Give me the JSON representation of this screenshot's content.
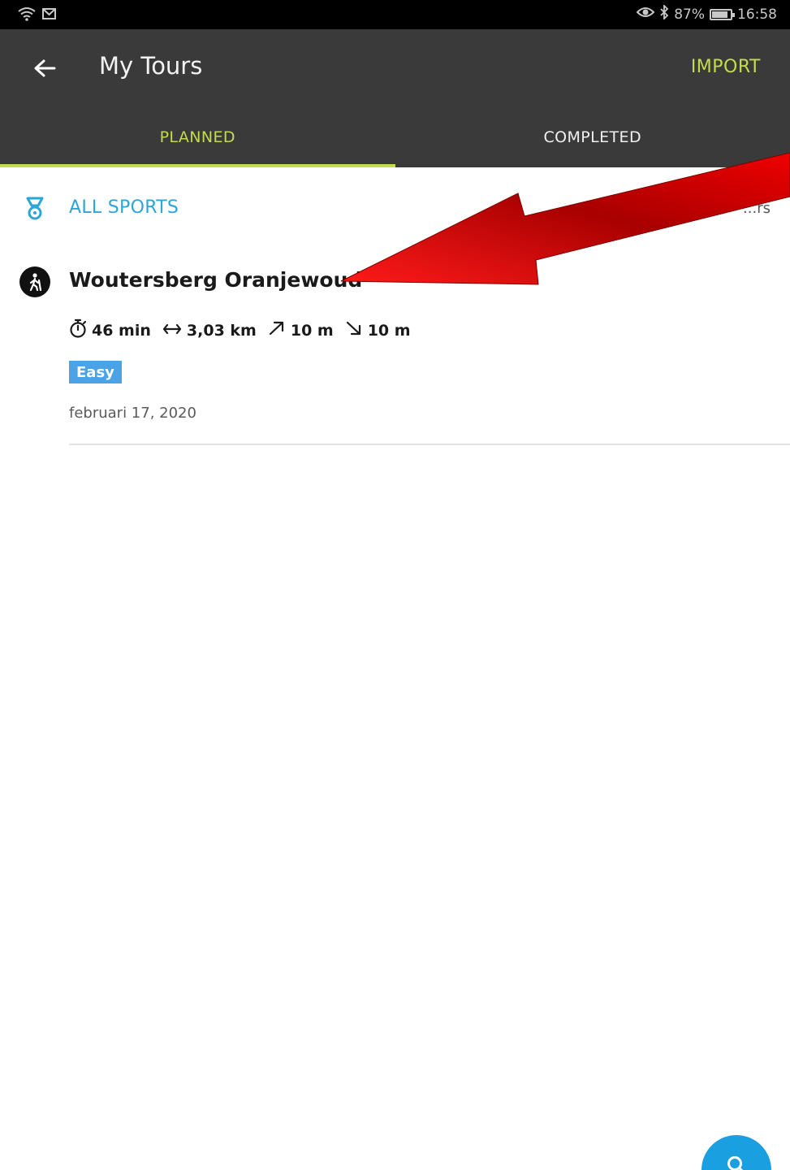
{
  "status_bar": {
    "left_icons": [
      "wifi-icon",
      "mail-icon"
    ],
    "right_icons": [
      "eye-icon",
      "bluetooth-icon",
      "battery-icon"
    ],
    "battery": "87%",
    "battery_level": 0.87,
    "time": "16:58"
  },
  "app_bar": {
    "back_icon": "back-arrow-icon",
    "title": "My Tours",
    "import_label": "IMPORT",
    "accent_color": "#c3dc4a",
    "background_color": "#3a3a3a"
  },
  "tabs": [
    {
      "label": "PLANNED",
      "active": true
    },
    {
      "label": "COMPLETED",
      "active": false
    }
  ],
  "filter": {
    "icon": "medal-icon",
    "label": "ALL SPORTS",
    "sort_label": "...rs",
    "color": "#2aa6d8"
  },
  "tours": [
    {
      "sport_icon": "hiking-icon",
      "name": "Woutersberg Oranjewoud",
      "duration": "46 min",
      "distance": "3,03 km",
      "uphill": "10 m",
      "downhill": "10 m",
      "difficulty": "Easy",
      "date": "februari 17, 2020"
    }
  ],
  "annotation": {
    "type": "red-arrow",
    "color": "#e00000"
  },
  "fab": {
    "icon": "search-icon",
    "color": "#1aa0e0"
  }
}
